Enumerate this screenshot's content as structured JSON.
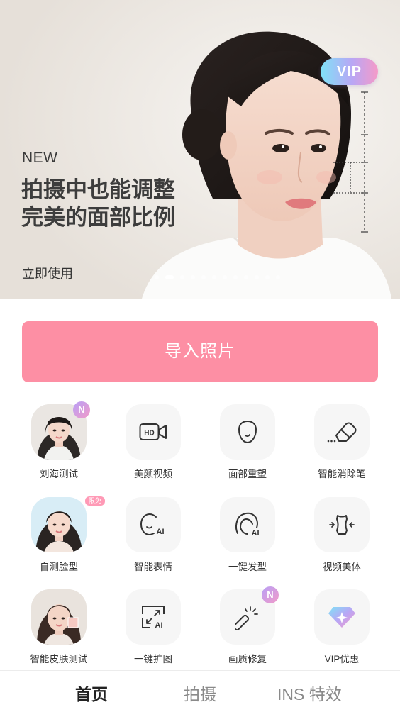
{
  "banner": {
    "new_label": "NEW",
    "title_line1": "拍摄中也能调整",
    "title_line2": "完美的面部比例",
    "cta": "立即使用",
    "vip_badge": "VIP",
    "carousel_count": 12,
    "carousel_active": 1
  },
  "import_button": "导入照片",
  "tools": [
    {
      "label": "刘海测试",
      "icon": "portrait-bangs-thumbnail",
      "badge": "N"
    },
    {
      "label": "美颜视频",
      "icon": "hd-video-icon"
    },
    {
      "label": "面部重塑",
      "icon": "face-outline-icon"
    },
    {
      "label": "智能消除笔",
      "icon": "eraser-icon"
    },
    {
      "label": "自测脸型",
      "icon": "portrait-face-thumbnail",
      "badge": "限免"
    },
    {
      "label": "智能表情",
      "icon": "ai-expression-icon"
    },
    {
      "label": "一键发型",
      "icon": "ai-hairstyle-icon"
    },
    {
      "label": "视频美体",
      "icon": "body-shape-icon"
    },
    {
      "label": "智能皮肤测试",
      "icon": "portrait-skin-thumbnail"
    },
    {
      "label": "一键扩图",
      "icon": "ai-expand-icon"
    },
    {
      "label": "画质修复",
      "icon": "magic-wand-icon",
      "badge": "N"
    },
    {
      "label": "VIP优惠",
      "icon": "diamond-icon"
    }
  ],
  "bottom_nav": [
    {
      "label": "首页",
      "active": true
    },
    {
      "label": "拍摄",
      "active": false
    },
    {
      "label": "INS 特效",
      "active": false
    }
  ],
  "colors": {
    "accent_pink": "#fd8fa4",
    "vip_gradient": [
      "#7fe2f7",
      "#b9a6f5",
      "#f59ac8"
    ],
    "badge_gradient": [
      "#b8a0f6",
      "#f29ac8"
    ]
  }
}
